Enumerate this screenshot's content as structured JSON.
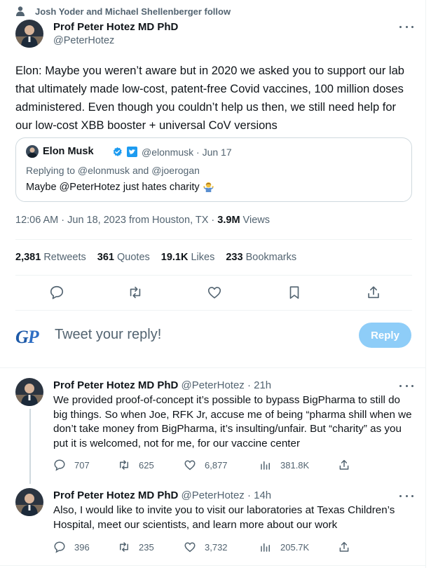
{
  "social_context": "Josh Yoder and Michael Shellenberger follow",
  "tweet": {
    "author_name": "Prof Peter Hotez MD PhD",
    "author_handle": "@PeterHotez",
    "text": "Elon: Maybe you weren’t aware but in 2020 we asked you to support our lab that ultimately made low-cost, patent-free Covid vaccines, 100 million doses administered. Even though you couldn’t help us then, we still need help for our low-cost XBB booster + universal CoV versions",
    "quote": {
      "author_name": "Elon Musk",
      "author_handle": "@elonmusk · Jun 17",
      "replying_to": "Replying to @elonmusk and @joerogan",
      "text": "Maybe @PeterHotez just hates charity"
    },
    "time": "12:06 AM · Jun 18, 2023 from Houston, TX · ",
    "views_count": "3.9M",
    "views_label": " Views",
    "stats": {
      "retweets_count": "2,381",
      "retweets_label": " Retweets",
      "quotes_count": "361",
      "quotes_label": " Quotes",
      "likes_count": "19.1K",
      "likes_label": " Likes",
      "bookmarks_count": "233",
      "bookmarks_label": " Bookmarks"
    }
  },
  "compose": {
    "logo": "GP",
    "placeholder": "Tweet your reply!",
    "reply_label": "Reply"
  },
  "replies": [
    {
      "author_name": "Prof Peter Hotez MD PhD",
      "meta": " @PeterHotez · 21h",
      "text": "We provided proof-of-concept it’s possible to bypass BigPharma to still do big things. So when Joe, RFK Jr, accuse me of being “pharma shill when we don’t take money from BigPharma, it’s insulting/unfair. But “charity” as you put it is welcomed, not for me, for our vaccine center",
      "replies": "707",
      "retweets": "625",
      "likes": "6,877",
      "views": "381.8K"
    },
    {
      "author_name": "Prof Peter Hotez MD PhD",
      "meta": " @PeterHotez · 14h",
      "text": "Also, I would like to invite you to visit our laboratories at Texas Children’s Hospital, meet our scientists, and learn more about our work",
      "replies": "396",
      "retweets": "235",
      "likes": "3,732",
      "views": "205.7K"
    }
  ],
  "icons": {
    "social": "person-icon",
    "more": "more-icon",
    "verified": "verified-badge-icon",
    "emoji": "person-shrugging-emoji",
    "reply": "reply-icon",
    "retweet": "retweet-icon",
    "like": "like-icon",
    "bookmark": "bookmark-icon",
    "share": "share-icon",
    "views": "views-icon"
  },
  "colors": {
    "accent": "#1d9bf0",
    "reply_button": "#8ecdf8",
    "secondary_text": "#536471"
  }
}
